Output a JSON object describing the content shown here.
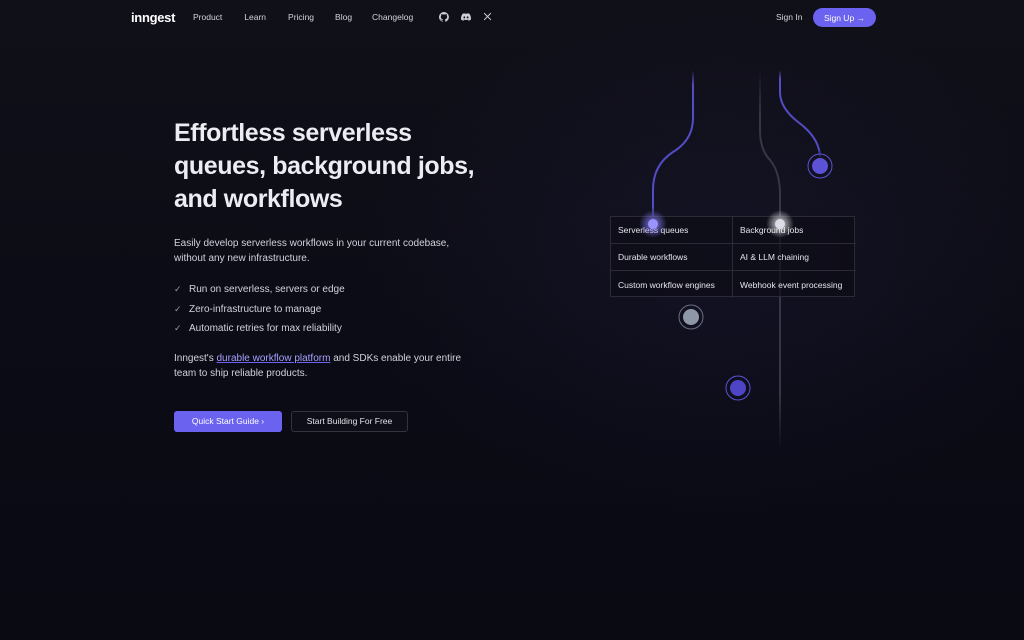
{
  "nav": {
    "logo": "inngest",
    "links": [
      "Product",
      "Learn",
      "Pricing",
      "Blog",
      "Changelog"
    ],
    "social_icons": [
      "github-icon",
      "discord-icon",
      "x-icon"
    ],
    "signin": "Sign In",
    "signup": "Sign Up →"
  },
  "hero": {
    "title": "Effortless serverless queues, background jobs, and workflows",
    "subtitle": "Easily develop serverless workflows in your current codebase, without any new infrastructure.",
    "checks": [
      "Run on serverless, servers or edge",
      "Zero-infrastructure to manage",
      "Automatic retries for max reliability"
    ],
    "para_prefix": "Inngest's ",
    "para_link": "durable workflow platform",
    "para_suffix": " and SDKs enable your entire team to ship reliable products.",
    "primary_cta": "Quick Start Guide ›",
    "secondary_cta": "Start Building For Free"
  },
  "features": [
    "Serverless queues",
    "Background jobs",
    "Durable workflows",
    "AI & LLM chaining",
    "Custom workflow engines",
    "Webhook event processing"
  ],
  "colors": {
    "accent": "#6b62f0",
    "background": "#0c0c16",
    "node_gray": "#8e97a8",
    "node_purple": "#5b52d6"
  }
}
